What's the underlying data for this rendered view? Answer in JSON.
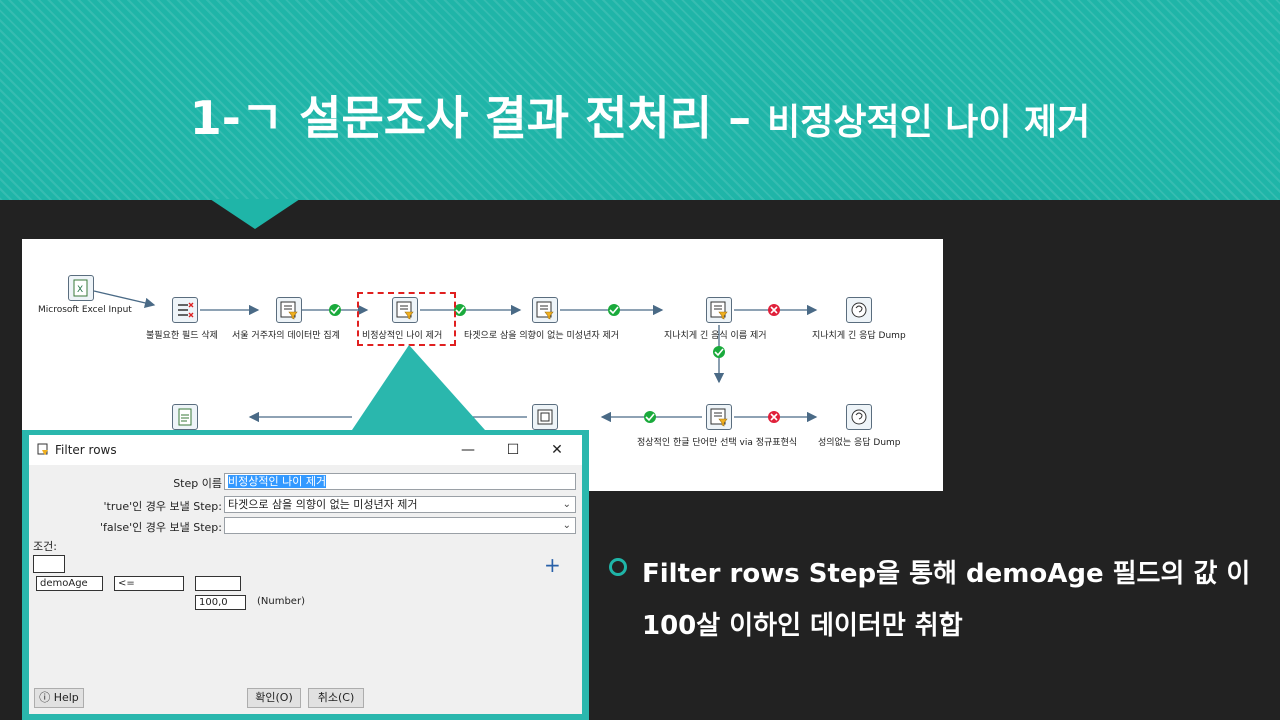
{
  "slide": {
    "title_main": "1-ㄱ 설문조사 결과 전처리 – ",
    "title_sub": "비정상적인 나이 제거",
    "bullet": "Filter rows Step을 통해 demoAge 필드의 값 이 100살 이하인 데이터만 취합"
  },
  "pipeline": {
    "steps": [
      {
        "id": "excel",
        "label": "Microsoft Excel Input",
        "icon": "excel-icon"
      },
      {
        "id": "drop",
        "label": "불필요한 필드 삭제",
        "icon": "select-values-icon"
      },
      {
        "id": "seoul",
        "label": "서울 거주자의 데이터만 집계",
        "icon": "filter-icon"
      },
      {
        "id": "age",
        "label": "비정상적인 나이 제거",
        "icon": "filter-icon"
      },
      {
        "id": "minor",
        "label": "타겟으로 삼을 의향이 없는 미성년자 제거",
        "icon": "filter-icon"
      },
      {
        "id": "long_food",
        "label": "지나치게 긴 음식 이름 제거",
        "icon": "script-filter-icon"
      },
      {
        "id": "long_dump",
        "label": "지나치게 긴 응답 Dump",
        "icon": "dummy-icon"
      },
      {
        "id": "regex",
        "label": "정상적인 한글 단어만 선택 via 정규표현식",
        "icon": "script-filter-icon"
      },
      {
        "id": "meaningless",
        "label": "성의없는 응답 Dump",
        "icon": "dummy-icon"
      }
    ]
  },
  "dialog": {
    "title": "Filter rows",
    "step_name_label": "Step 이름",
    "step_name_value": "비정상적인 나이 제거",
    "true_label": "'true'인 경우 보낼 Step:",
    "true_value": "타겟으로 삼을 의향이 없는 미성년자 제거",
    "false_label": "'false'인 경우 보낼 Step:",
    "false_value": "",
    "condition_label": "조건:",
    "field": "demoAge",
    "operator": "<=",
    "value": "100,0",
    "value_type": "(Number)",
    "plus": "+",
    "help": "Help",
    "ok": "확인(O)",
    "cancel": "취소(C)",
    "minimize": "—",
    "maximize": "☐",
    "close": "✕"
  },
  "colors": {
    "accent": "#1fb5a8",
    "background": "#222222",
    "ok_hop": "#1aaa3c",
    "error_hop": "#e0203a"
  }
}
